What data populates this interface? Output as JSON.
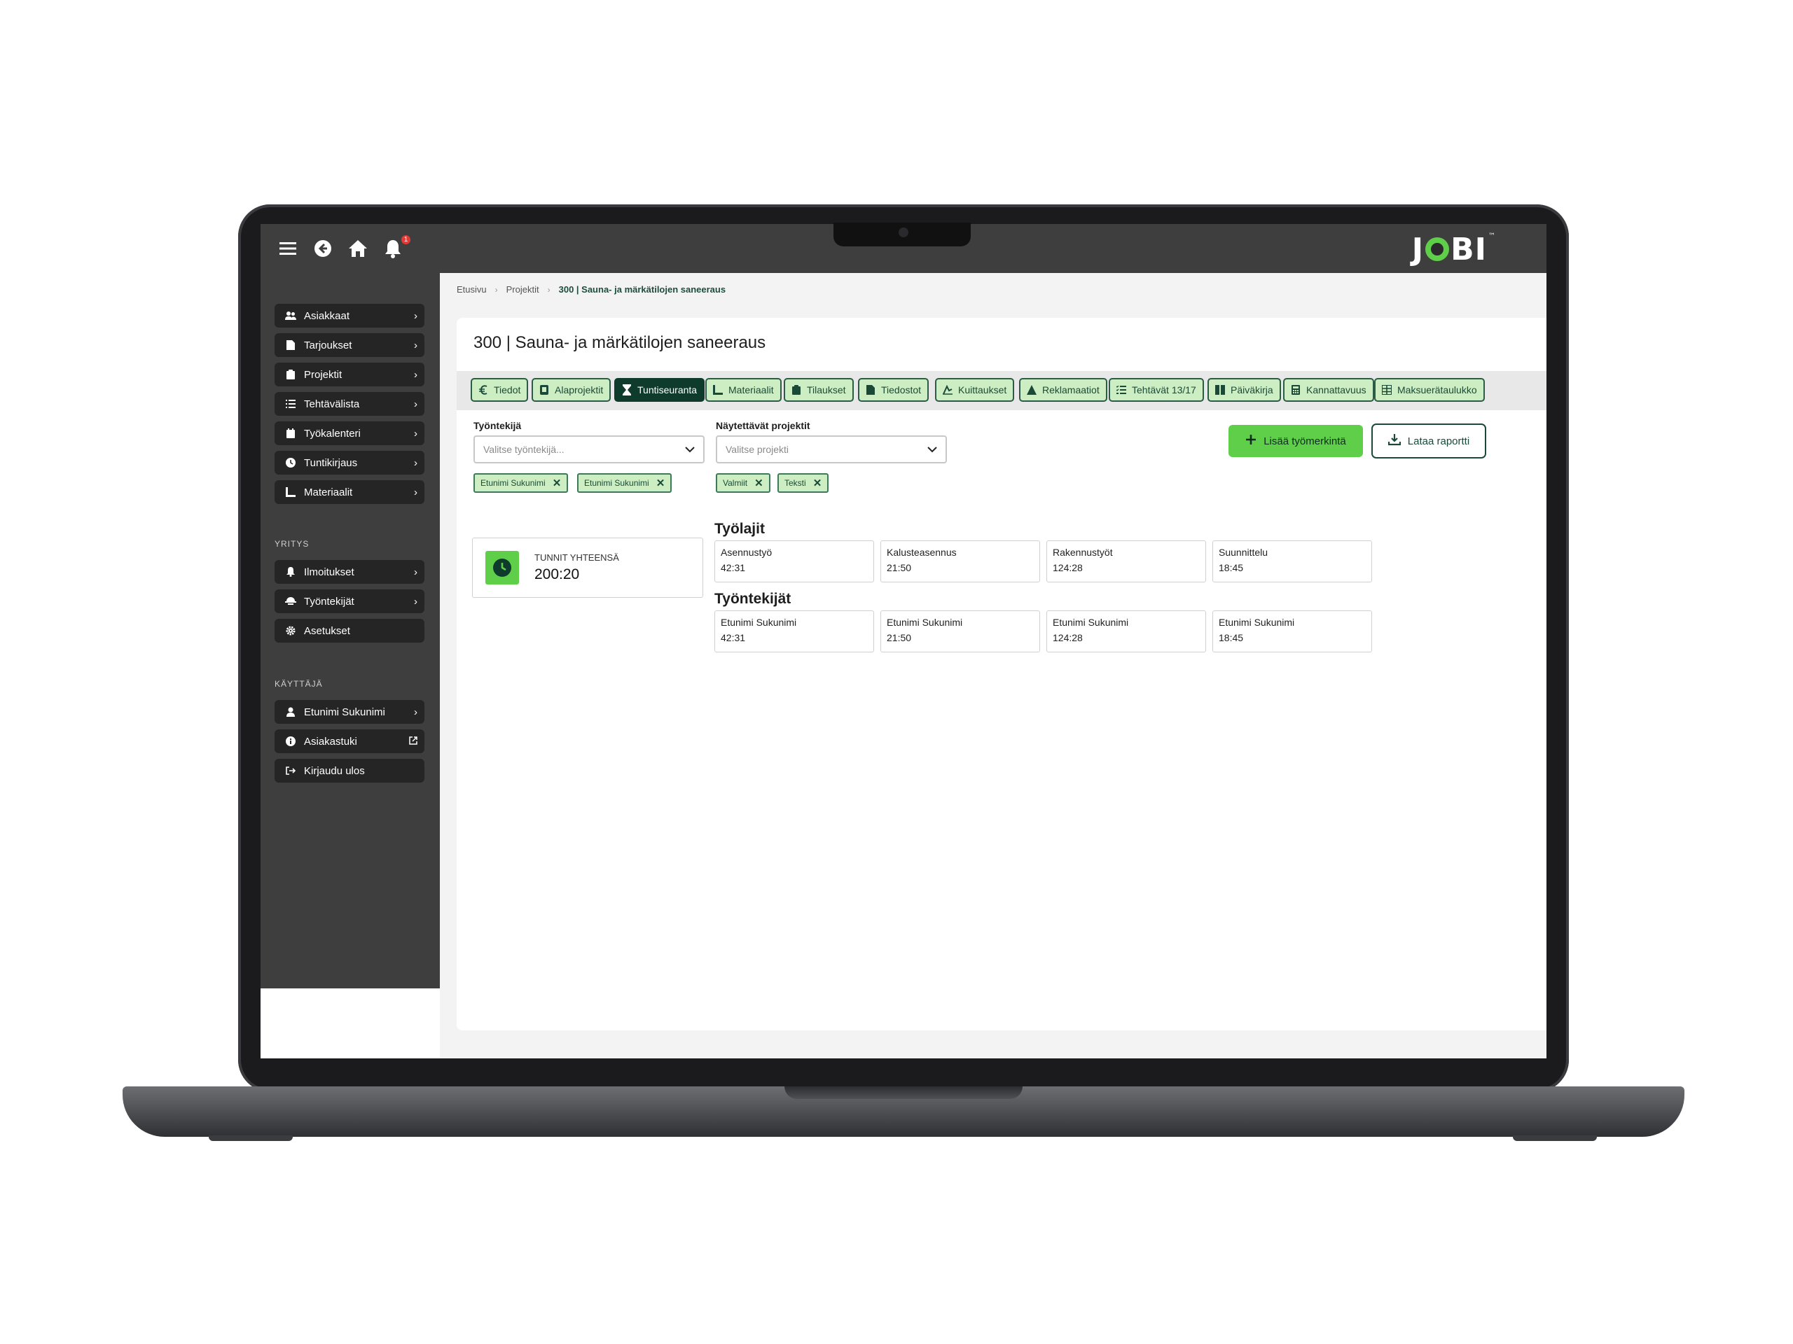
{
  "header": {
    "notification_count": "1",
    "logo_left": "J",
    "logo_right": "BI",
    "logo_mark": "™"
  },
  "icons": {
    "menu": "hamburger-icon",
    "back": "back-arrow-icon",
    "home": "home-icon",
    "notifications": "bell-icon"
  },
  "sidebar": {
    "main_items": [
      {
        "label": "Asiakkaat",
        "icon": "users-icon"
      },
      {
        "label": "Tarjoukset",
        "icon": "document-icon"
      },
      {
        "label": "Projektit",
        "icon": "clipboard-icon"
      },
      {
        "label": "Tehtävälista",
        "icon": "list-icon"
      },
      {
        "label": "Työkalenteri",
        "icon": "calendar-icon"
      },
      {
        "label": "Tuntikirjaus",
        "icon": "clock-icon"
      },
      {
        "label": "Materiaalit",
        "icon": "ruler-icon"
      }
    ],
    "company_heading": "YRITYS",
    "company_items": [
      {
        "label": "Ilmoitukset",
        "icon": "bell-icon"
      },
      {
        "label": "Työntekijät",
        "icon": "workers-icon"
      },
      {
        "label": "Asetukset",
        "icon": "gear-icon"
      }
    ],
    "user_heading": "KÄYTTÄJÄ",
    "user_items": [
      {
        "label": "Etunimi Sukunimi",
        "icon": "user-icon"
      },
      {
        "label": "Asiakastuki",
        "icon": "info-icon"
      },
      {
        "label": "Kirjaudu ulos",
        "icon": "logout-icon"
      }
    ]
  },
  "breadcrumb": {
    "items": [
      "Etusivu",
      "Projektit",
      "300 | Sauna- ja märkätilojen saneeraus"
    ]
  },
  "page": {
    "title": "300 | Sauna- ja märkätilojen saneeraus"
  },
  "tabs": [
    {
      "label": "Tiedot",
      "icon": "euro-icon"
    },
    {
      "label": "Alaprojektit",
      "icon": "folder-icon"
    },
    {
      "label": "Tuntiseuranta",
      "icon": "hourglass-icon",
      "active": true
    },
    {
      "label": "Materiaalit",
      "icon": "ruler-icon"
    },
    {
      "label": "Tilaukset",
      "icon": "clipboard-icon"
    },
    {
      "label": "Tiedostot",
      "icon": "file-icon"
    },
    {
      "label": "Kuittaukset",
      "icon": "signature-icon"
    },
    {
      "label": "Reklamaatiot",
      "icon": "warning-icon"
    },
    {
      "label": "Tehtävät 13/17",
      "icon": "checklist-icon"
    },
    {
      "label": "Päiväkirja",
      "icon": "book-icon"
    },
    {
      "label": "Kannattavuus",
      "icon": "calculator-icon"
    },
    {
      "label": "Maksuerätaulukko",
      "icon": "table-icon"
    }
  ],
  "filters": {
    "employee": {
      "label": "Työntekijä",
      "placeholder": "Valitse työntekijä...",
      "chips": [
        "Etunimi Sukunimi",
        "Etunimi Sukunimi"
      ]
    },
    "projects": {
      "label": "Näytettävät projektit",
      "placeholder": "Valitse projekti",
      "chips": [
        "Valmiit",
        "Teksti"
      ]
    }
  },
  "actions": {
    "add_entry": "Lisää työmerkintä",
    "download_report": "Lataa raportti"
  },
  "summary": {
    "label": "TUNNIT YHTEENSÄ",
    "value": "200:20"
  },
  "work_types": {
    "title": "Työlajit",
    "items": [
      {
        "label": "Asennustyö",
        "value": "42:31"
      },
      {
        "label": "Kalusteasennus",
        "value": "21:50"
      },
      {
        "label": "Rakennustyöt",
        "value": "124:28"
      },
      {
        "label": "Suunnittelu",
        "value": "18:45"
      }
    ]
  },
  "employees": {
    "title": "Työntekijät",
    "items": [
      {
        "label": "Etunimi Sukunimi",
        "value": "42:31"
      },
      {
        "label": "Etunimi Sukunimi",
        "value": "21:50"
      },
      {
        "label": "Etunimi Sukunimi",
        "value": "124:28"
      },
      {
        "label": "Etunimi Sukunimi",
        "value": "18:45"
      }
    ]
  },
  "colors": {
    "accent_green": "#5fce49",
    "dark_green": "#0e3b2c",
    "chip_green": "#cdeec3",
    "sidebar_bg": "#3e3e3e"
  }
}
